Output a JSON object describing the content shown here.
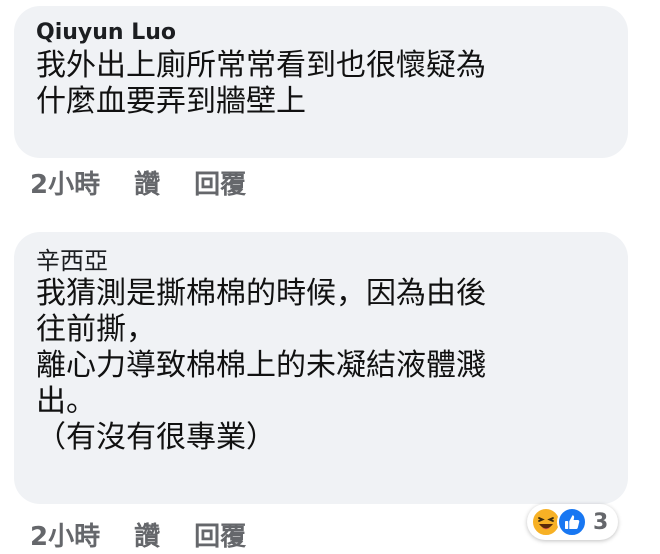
{
  "comments": [
    {
      "author": "Qiuyun Luo",
      "text": "我外出上廁所常常看到也很懷疑為\n什麼血要弄到牆壁上",
      "time": "2小時",
      "like_label": "讚",
      "reply_label": "回覆"
    },
    {
      "author": "辛西亞",
      "text": "我猜測是撕棉棉的時候，因為由後\n往前撕，\n離心力導致棉棉上的未凝結液體濺\n出。\n（有沒有很專業）",
      "time": "2小時",
      "like_label": "讚",
      "reply_label": "回覆",
      "reactions": {
        "icons": [
          "laughing-emoji-icon",
          "like-thumb-icon"
        ],
        "count": "3"
      }
    }
  ],
  "colors": {
    "bubble": "#f0f2f5",
    "meta_text": "#65676b",
    "like_blue": "#1877f2",
    "haha_yellow": "#f7b125"
  }
}
